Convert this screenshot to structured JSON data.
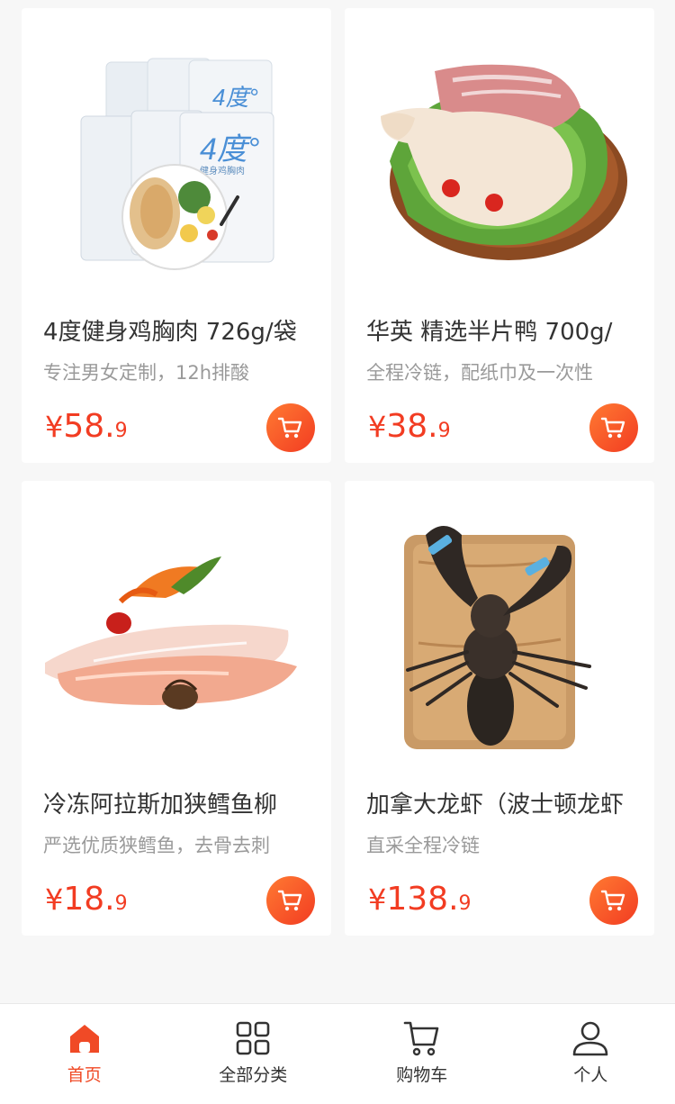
{
  "products": [
    {
      "title": "4度健身鸡胸肉 726g/袋",
      "desc": "专注男女定制，12h排酸",
      "currency": "¥",
      "price_int": "58.",
      "price_dec": "9"
    },
    {
      "title": "华英 精选半片鸭 700g/",
      "desc": "全程冷链，配纸巾及一次性",
      "currency": "¥",
      "price_int": "38.",
      "price_dec": "9"
    },
    {
      "title": "冷冻阿拉斯加狭鳕鱼柳",
      "desc": "严选优质狭鳕鱼，去骨去刺",
      "currency": "¥",
      "price_int": "18.",
      "price_dec": "9"
    },
    {
      "title": "加拿大龙虾（波士顿龙虾",
      "desc": "直采全程冷链",
      "currency": "¥",
      "price_int": "138.",
      "price_dec": "9"
    }
  ],
  "product_image_texts": {
    "pack_brand": "4度°",
    "pack_sub": "健身鸡胸肉"
  },
  "tabbar": {
    "active_index": 0,
    "tabs": [
      {
        "label": "首页",
        "icon": "home-icon"
      },
      {
        "label": "全部分类",
        "icon": "grid-icon"
      },
      {
        "label": "购物车",
        "icon": "cart-icon"
      },
      {
        "label": "个人",
        "icon": "user-icon"
      }
    ]
  },
  "colors": {
    "accent": "#f23c22",
    "tab_active": "#f04a26",
    "text": "#333333",
    "subtext": "#9a9a9a"
  }
}
